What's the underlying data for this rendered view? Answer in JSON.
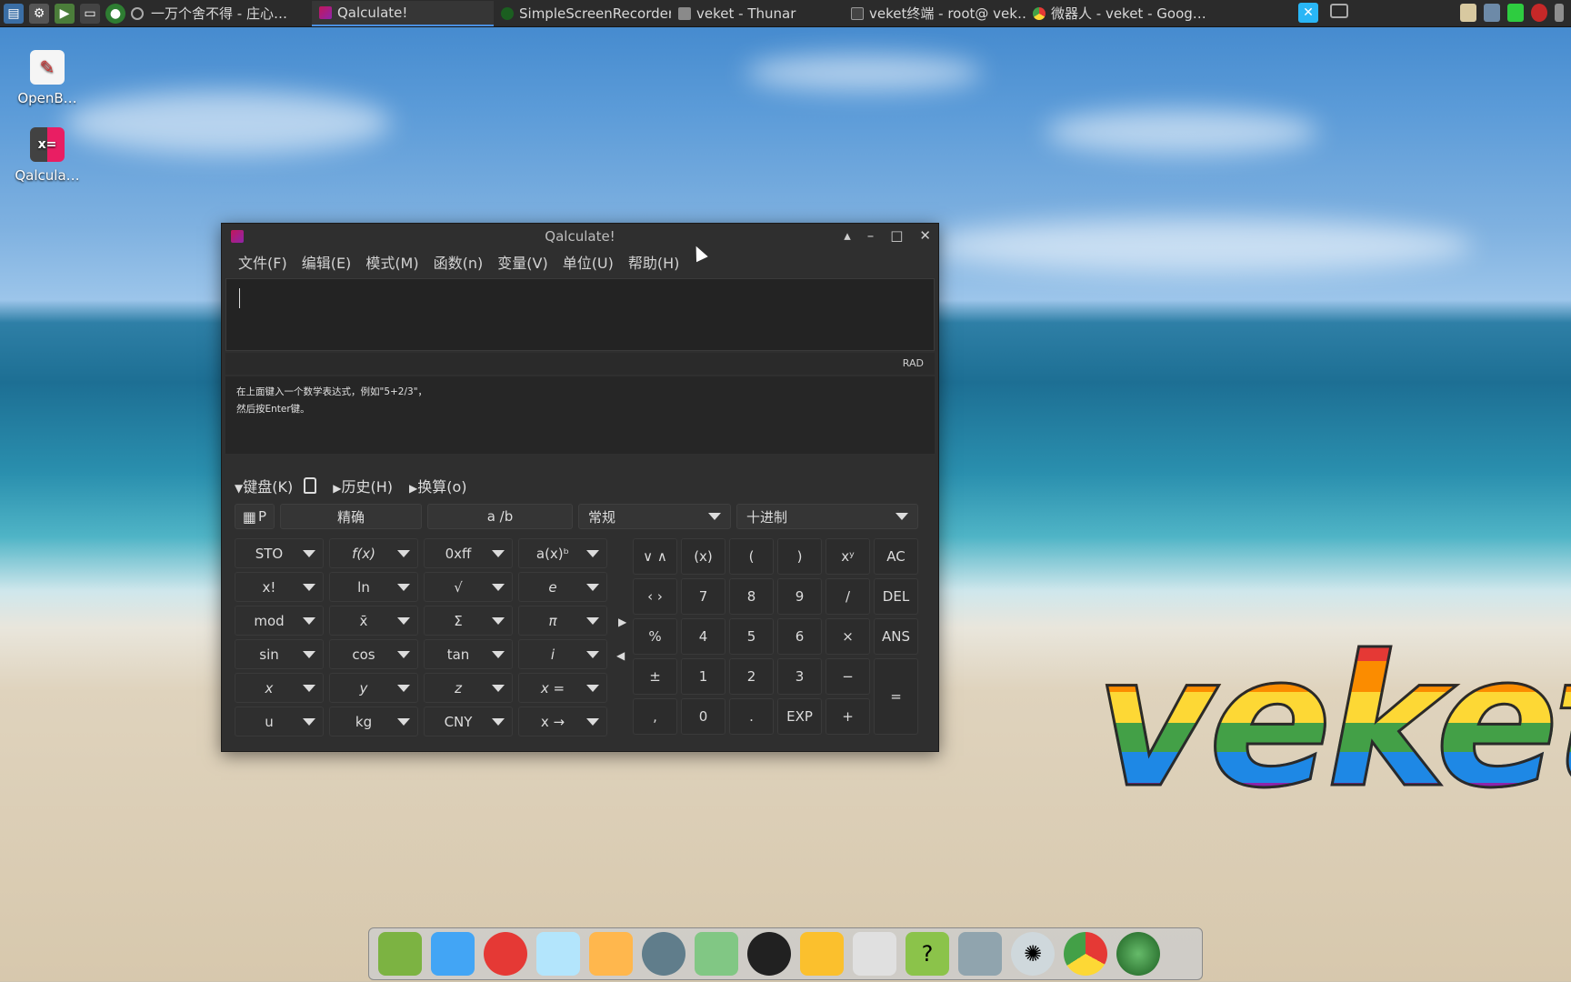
{
  "taskbar": {
    "tasks": [
      {
        "label": "一万个舍不得 - 庄心…",
        "active": false
      },
      {
        "label": "Qalculate!",
        "active": true
      },
      {
        "label": "SimpleScreenRecorder",
        "active": false
      },
      {
        "label": "veket - Thunar",
        "active": false
      },
      {
        "label": "veket终端 - root@ vek…",
        "active": false
      },
      {
        "label": "微器人 - veket - Goog…",
        "active": false
      }
    ]
  },
  "desktop": {
    "icons": [
      {
        "label": "OpenB…"
      },
      {
        "label": "Qalcula…"
      }
    ],
    "logo_text": "veket"
  },
  "window": {
    "title": "Qalculate!",
    "menu": [
      "文件(F)",
      "编辑(E)",
      "模式(M)",
      "函数(n)",
      "变量(V)",
      "单位(U)",
      "帮助(H)"
    ],
    "angle_mode": "RAD",
    "hint_line1": "在上面键入一个数学表达式，例如\"5+2/3\"，",
    "hint_line2": "然后按Enter键。",
    "sections": {
      "keyboard": "键盘(K)",
      "history": "历史(H)",
      "conversion": "换算(o)"
    },
    "mode_row": {
      "p_label": "P",
      "exact": "精确",
      "fraction": "a /b",
      "format": "常规",
      "base": "十进制"
    },
    "function_buttons": [
      "STO",
      "f(x)",
      "0xff",
      "a(x)ᵇ",
      "x!",
      "ln",
      "√",
      "e",
      "mod",
      "x̄",
      "Σ",
      "π",
      "sin",
      "cos",
      "tan",
      "i",
      "x",
      "y",
      "z",
      "x =",
      "u",
      "kg",
      "CNY",
      "x →"
    ],
    "keypad": [
      "∨ ∧",
      "(x)",
      "(",
      ")",
      "xʸ",
      "AC",
      "‹ ›",
      "7",
      "8",
      "9",
      "/",
      "DEL",
      "%",
      "4",
      "5",
      "6",
      "×",
      "ANS",
      "±",
      "1",
      "2",
      "3",
      "−",
      "=",
      ",",
      "0",
      ".",
      "EXP",
      "+"
    ]
  },
  "colors": {
    "window_bg": "#2f2f2f",
    "accent": "#4a90e2"
  }
}
